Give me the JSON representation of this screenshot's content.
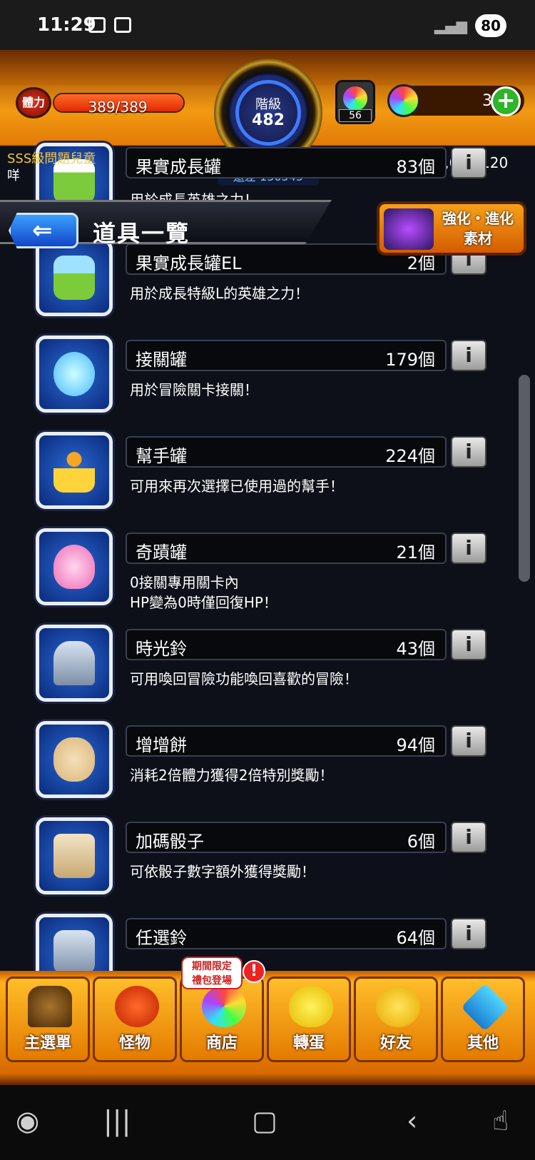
{
  "status_bar": {
    "time": "11:29",
    "battery": "80"
  },
  "hud": {
    "stamina_label": "體力",
    "stamina": "389/389",
    "stamina_fraction": 1.0,
    "rank_label": "階級",
    "rank": "482",
    "rank_diff": "還差 130545",
    "orb_crate_count": "56",
    "orbs": "3",
    "gold": "326,687,120",
    "player_title": "SSS級問題兒童",
    "player_name": "咩"
  },
  "header": {
    "title": "道具一覽",
    "enhance_label": "強化・進化\n素材"
  },
  "items": [
    {
      "name": "果實成長罐",
      "count": "83個",
      "desc": "用於成長英雄之力！"
    },
    {
      "name": "果實成長罐EL",
      "count": "2個",
      "desc": "用於成長特級L的英雄之力！"
    },
    {
      "name": "接關罐",
      "count": "179個",
      "desc": "用於冒險關卡接關！"
    },
    {
      "name": "幫手罐",
      "count": "224個",
      "desc": "可用來再次選擇已使用過的幫手！"
    },
    {
      "name": "奇蹟罐",
      "count": "21個",
      "desc": "0接關專用關卡內\nHP變為0時僅回復HP！"
    },
    {
      "name": "時光鈴",
      "count": "43個",
      "desc": "可用喚回冒險功能喚回喜歡的冒險！"
    },
    {
      "name": "增增餅",
      "count": "94個",
      "desc": "消耗2倍體力獲得2倍特別獎勵！"
    },
    {
      "name": "加碼骰子",
      "count": "6個",
      "desc": "可依骰子數字額外獲得獎勵！"
    },
    {
      "name": "任選鈴",
      "count": "64個",
      "desc": ""
    }
  ],
  "info_label": "i",
  "nav": {
    "tabs": [
      "主選單",
      "怪物",
      "商店",
      "轉蛋",
      "好友",
      "其他"
    ],
    "promo": "期間限定\n禮包登場",
    "alert": "!"
  },
  "colors": {
    "accent": "#f29a12",
    "list_bg": "#0d1018",
    "icon_blue": "#1f5fd0"
  }
}
